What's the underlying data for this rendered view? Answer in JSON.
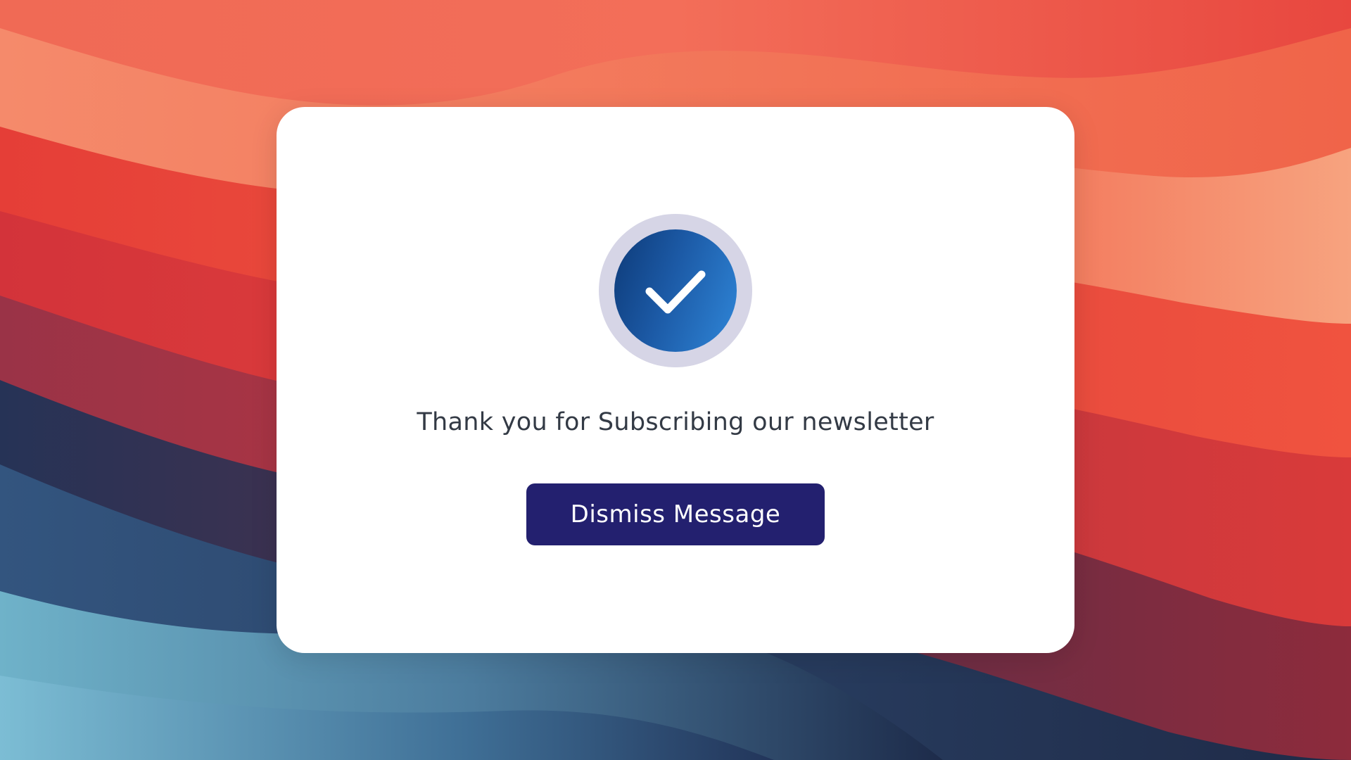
{
  "theme": {
    "background_top": "#f05a45",
    "background_bottom": "#1f2d4d",
    "accent_blue": "#2f86d8",
    "button_color": "#23206f"
  },
  "dialog": {
    "icon": "check-circle-icon",
    "message": "Thank you for Subscribing our newsletter",
    "dismiss_label": "Dismiss Message"
  }
}
